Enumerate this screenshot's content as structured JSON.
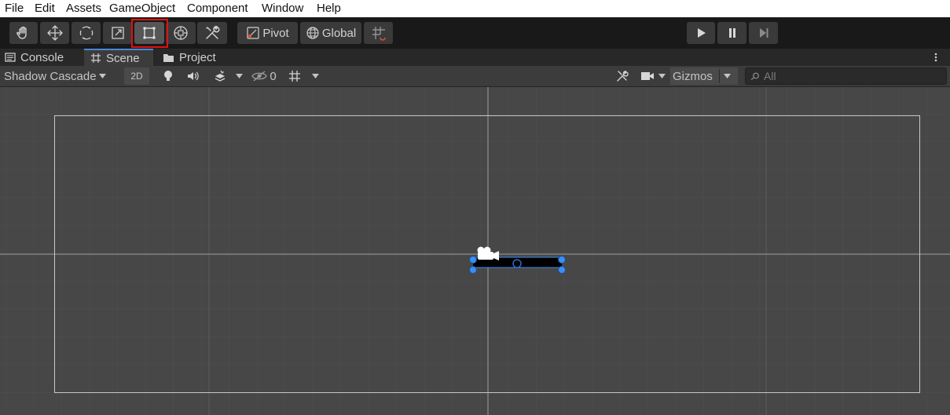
{
  "menu": [
    "File",
    "Edit",
    "Assets",
    "GameObject",
    "Component",
    "Window",
    "Help"
  ],
  "toolbar": {
    "pivot_label": "Pivot",
    "global_label": "Global",
    "tools": [
      "hand-icon",
      "move-icon",
      "rotate-icon",
      "scale-icon",
      "rect-tool-icon",
      "transform-icon",
      "custom-tool-icon"
    ],
    "selected_tool": "rect-tool-icon",
    "highlight_color": "#e01010"
  },
  "tabs": [
    {
      "label": "Console",
      "icon": "console-icon"
    },
    {
      "label": "Scene",
      "icon": "grid-icon",
      "active": true
    },
    {
      "label": "Project",
      "icon": "folder-icon"
    }
  ],
  "scenebar": {
    "draw_mode": "Shadow Cascade",
    "mode_2d": "2D",
    "hidden_count": "0",
    "gizmos_label": "Gizmos",
    "search_placeholder": "All"
  },
  "colors": {
    "toolbar_bg": "#191919",
    "scene_bg": "#474747",
    "selection_handle": "#3c8ef0",
    "active_tab_accent": "#4b86d8"
  }
}
